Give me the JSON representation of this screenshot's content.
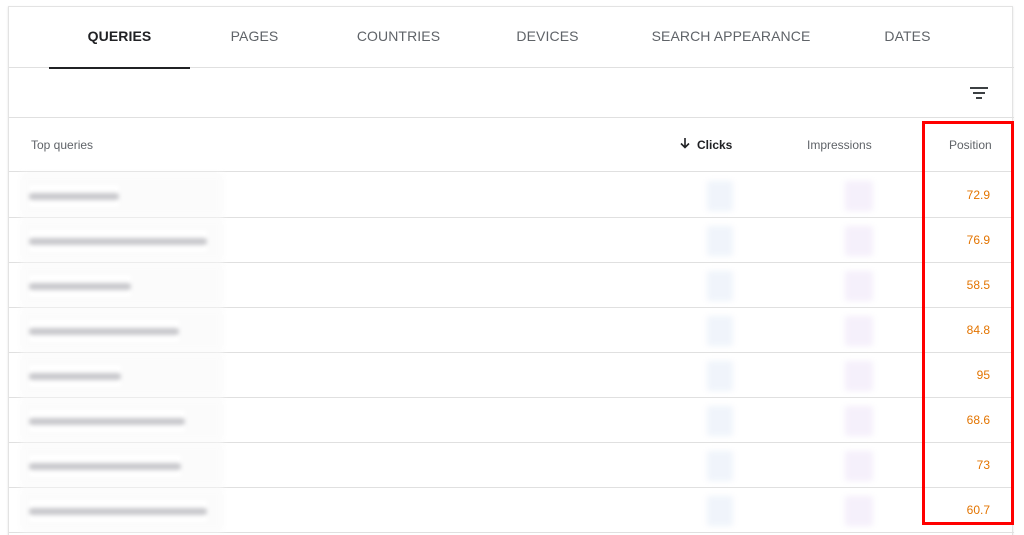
{
  "tabs": [
    {
      "label": "QUERIES",
      "active": true
    },
    {
      "label": "PAGES",
      "active": false
    },
    {
      "label": "COUNTRIES",
      "active": false
    },
    {
      "label": "DEVICES",
      "active": false
    },
    {
      "label": "SEARCH APPEARANCE",
      "active": false
    },
    {
      "label": "DATES",
      "active": false
    }
  ],
  "toolbar": {
    "filter_icon": "filter-list-icon"
  },
  "table": {
    "columns": {
      "query": "Top queries",
      "clicks": "Clicks",
      "impressions": "Impressions",
      "position": "Position"
    },
    "sorted_by": "Clicks",
    "sort_direction": "descending",
    "rows": [
      {
        "position": "72.9"
      },
      {
        "position": "76.9"
      },
      {
        "position": "58.5"
      },
      {
        "position": "84.8"
      },
      {
        "position": "95"
      },
      {
        "position": "68.6"
      },
      {
        "position": "73"
      },
      {
        "position": "60.7"
      }
    ]
  },
  "colors": {
    "position_text": "#e37400",
    "highlight": "#ff0000",
    "active_tab": "#202124"
  }
}
